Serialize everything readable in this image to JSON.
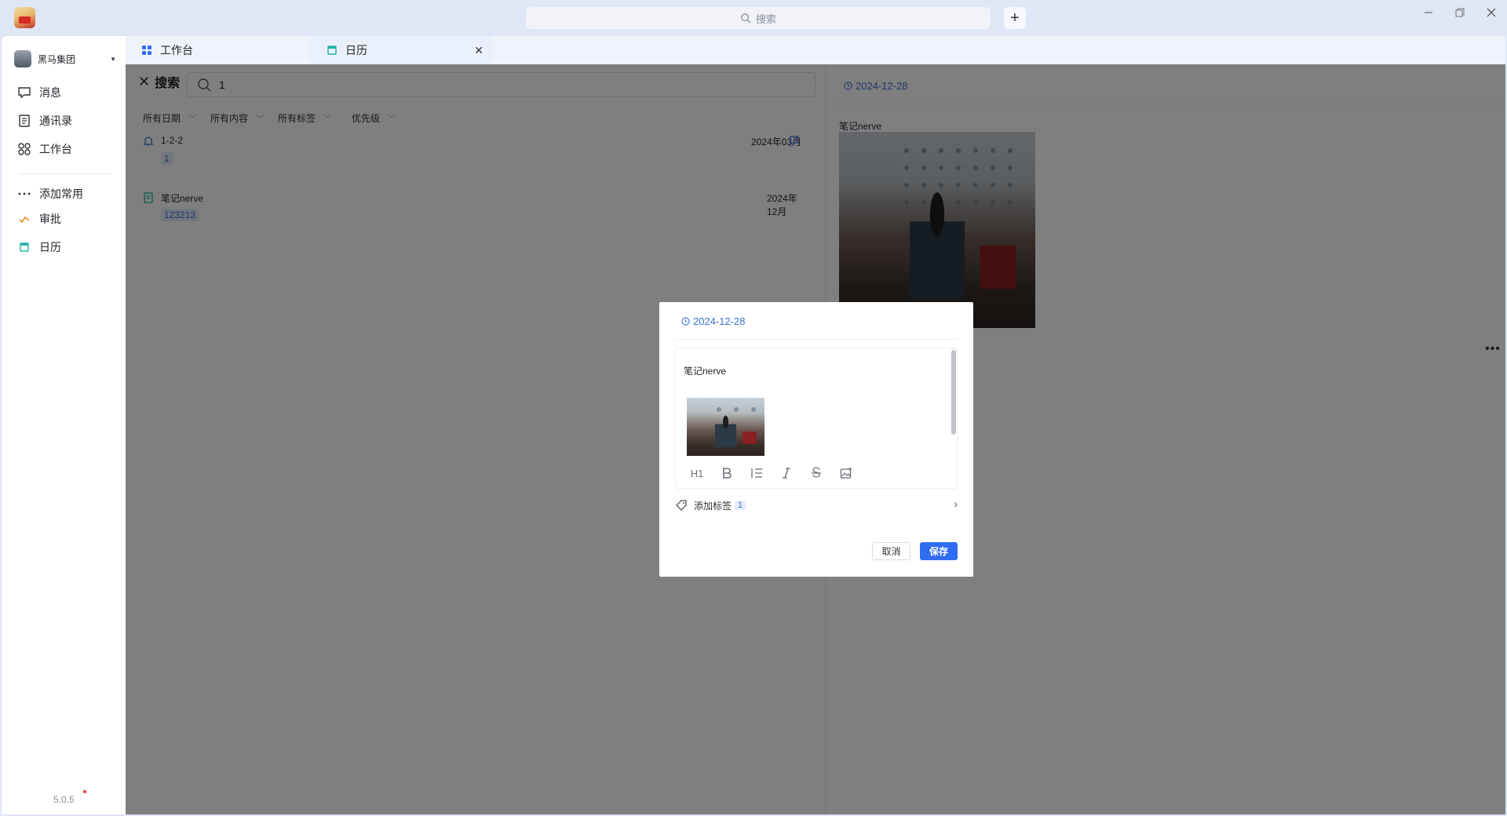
{
  "titlebar": {
    "search_placeholder": "搜索",
    "add_label": "+"
  },
  "sidebar": {
    "org_name": "黑马集团",
    "items": [
      {
        "label": "消息",
        "icon": "message-icon"
      },
      {
        "label": "通讯录",
        "icon": "contacts-icon"
      },
      {
        "label": "工作台",
        "icon": "workbench-icon"
      }
    ],
    "apps": [
      {
        "label": "添加常用",
        "icon": "more-icon"
      },
      {
        "label": "审批",
        "icon": "approval-icon"
      },
      {
        "label": "日历",
        "icon": "calendar-icon"
      }
    ],
    "version": "5.0.5"
  },
  "tabs": [
    {
      "label": "工作台",
      "icon": "workbench-icon"
    },
    {
      "label": "日历",
      "icon": "calendar-icon",
      "active": true
    }
  ],
  "search": {
    "title": "搜索",
    "query": "1",
    "filters": [
      "所有日期",
      "所有内容",
      "所有标签",
      "优先级"
    ]
  },
  "results": [
    {
      "title": "1-2-2",
      "date": "2024年03月",
      "tag": "1",
      "icon": "bell-icon",
      "flagged": true
    },
    {
      "title": "笔记nerve",
      "date": "2024年12月",
      "tag": "123213",
      "icon": "note-icon",
      "flagged": false
    }
  ],
  "detail": {
    "date": "2024-12-28",
    "note_title": "笔记nerve"
  },
  "modal": {
    "date": "2024-12-28",
    "content_text": "笔记nerve",
    "toolbar": {
      "h1": "H1"
    },
    "tag_label": "添加标签",
    "tag_count": "1",
    "cancel_label": "取消",
    "save_label": "保存"
  },
  "colors": {
    "accent": "#2f6cf2",
    "link": "#3b6fd9",
    "titlebar_bg": "#dfe6f5"
  }
}
